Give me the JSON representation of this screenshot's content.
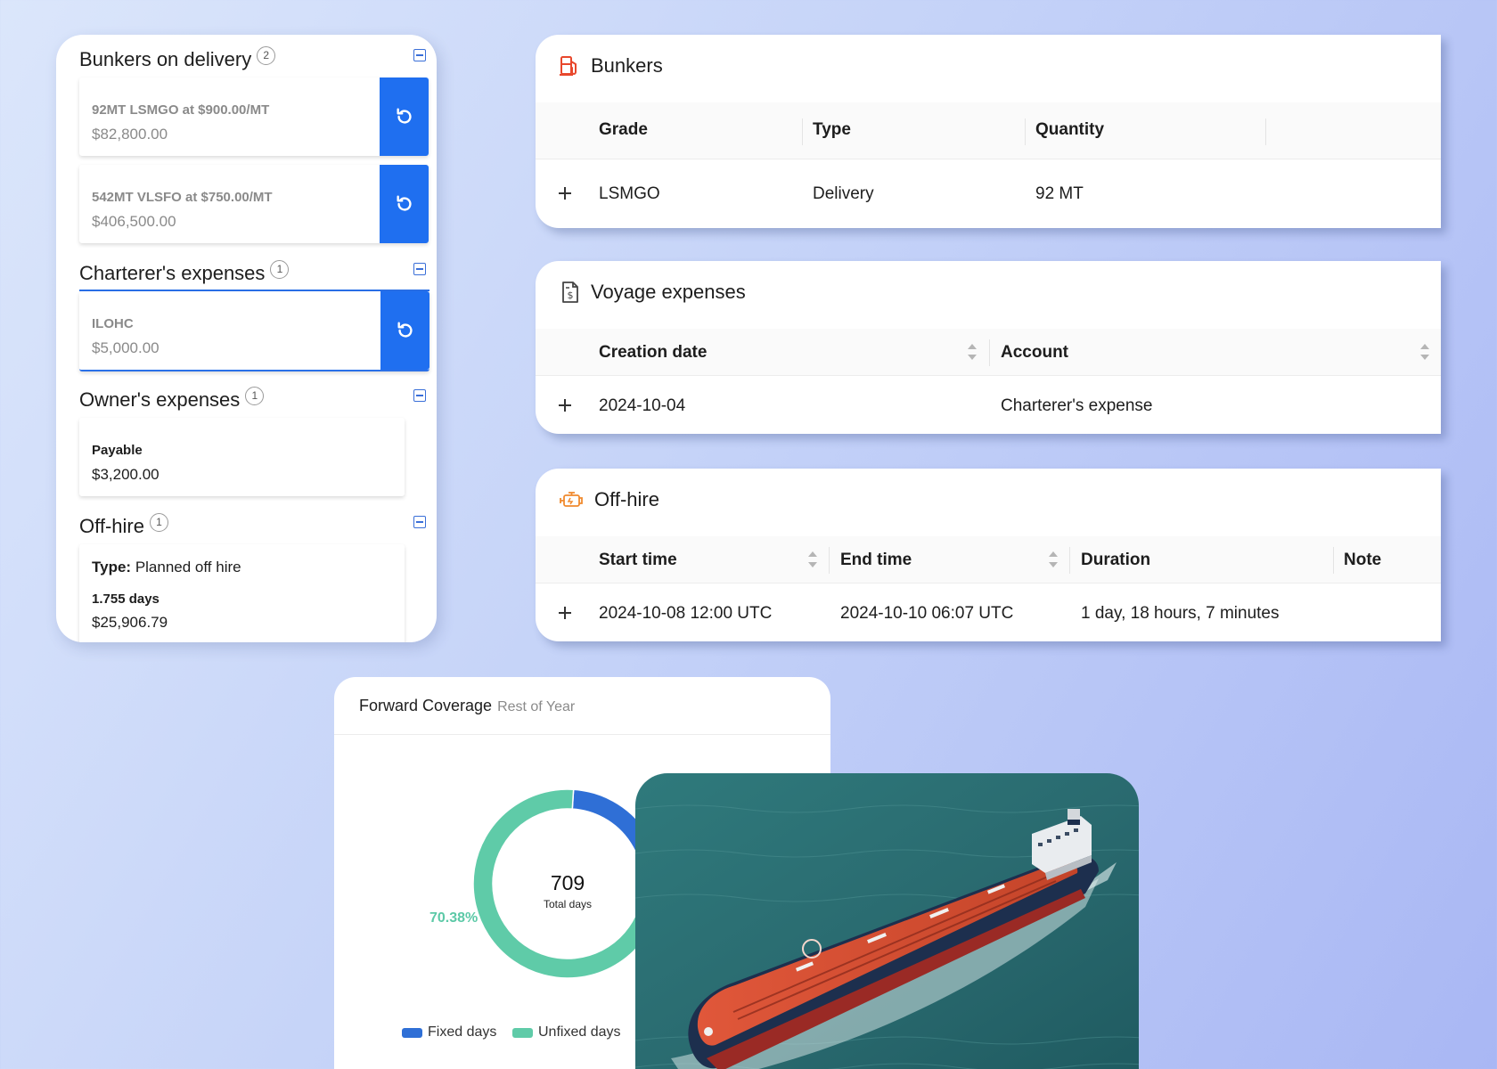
{
  "left_panel": {
    "bunkers_on_delivery": {
      "title": "Bunkers on delivery",
      "count": "2",
      "items": [
        {
          "line1": "92MT LSMGO at $900.00/MT",
          "line2": "$82,800.00"
        },
        {
          "line1": "542MT VLSFO at $750.00/MT",
          "line2": "$406,500.00"
        }
      ]
    },
    "charterers_expenses": {
      "title": "Charterer's expenses",
      "count": "1",
      "items": [
        {
          "line1": "ILOHC",
          "line2": "$5,000.00"
        }
      ]
    },
    "owners_expenses": {
      "title": "Owner's expenses",
      "count": "1",
      "items": [
        {
          "line1": "Payable",
          "line2": "$3,200.00"
        }
      ]
    },
    "off_hire": {
      "title": "Off-hire",
      "count": "1",
      "type_label": "Type:",
      "type_value": "Planned off hire",
      "days": "1.755 days",
      "amount": "$25,906.79"
    }
  },
  "bunkers_table": {
    "title": "Bunkers",
    "columns": [
      "Grade",
      "Type",
      "Quantity"
    ],
    "rows": [
      {
        "grade": "LSMGO",
        "type": "Delivery",
        "quantity": "92 MT"
      }
    ]
  },
  "voyage_expenses_table": {
    "title": "Voyage expenses",
    "columns": [
      "Creation date",
      "Account"
    ],
    "rows": [
      {
        "creation_date": "2024-10-04",
        "account": "Charterer's expense"
      }
    ]
  },
  "off_hire_table": {
    "title": "Off-hire",
    "columns": [
      "Start time",
      "End time",
      "Duration",
      "Note"
    ],
    "rows": [
      {
        "start": "2024-10-08 12:00 UTC",
        "end": "2024-10-10 06:07 UTC",
        "duration": "1 day, 18 hours, 7 minutes",
        "note": ""
      }
    ]
  },
  "forward_coverage": {
    "title": "Forward Coverage",
    "subtitle": "Rest of Year",
    "total": "709",
    "total_label": "Total days",
    "unfixed_pct_label": "70.38%",
    "legend": [
      {
        "name": "Fixed days",
        "color": "#2f6fd6"
      },
      {
        "name": "Unfixed days",
        "color": "#5fcba8"
      }
    ]
  },
  "chart_data": {
    "type": "pie",
    "title": "Forward Coverage",
    "subtitle": "Rest of Year",
    "categories": [
      "Fixed days",
      "Unfixed days"
    ],
    "values": [
      29.62,
      70.38
    ],
    "unit": "%",
    "total_days": 709,
    "legend": "bottom"
  },
  "colors": {
    "accent": "#1f6ff0",
    "fixed": "#2f6fd6",
    "unfixed": "#5fcba8",
    "bunker_icon": "#e8472c",
    "offhire_icon": "#f08a2e"
  }
}
